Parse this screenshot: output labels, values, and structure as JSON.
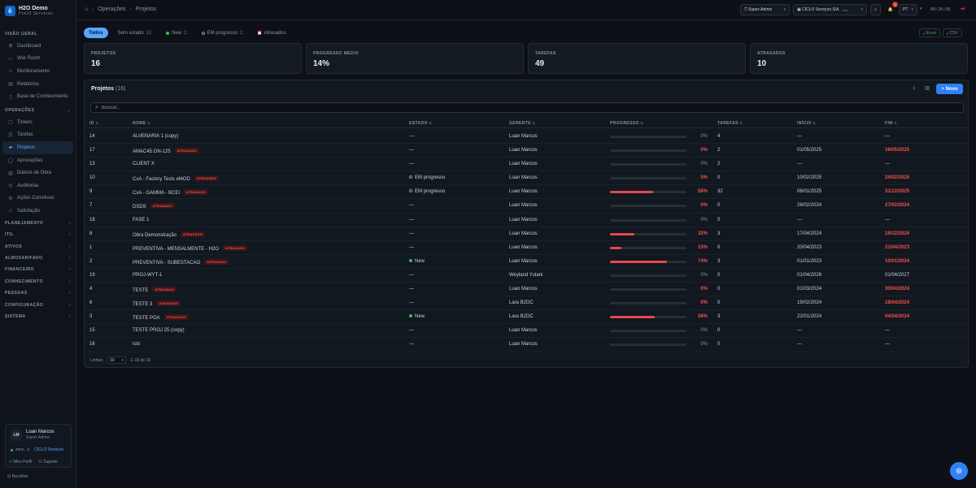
{
  "brand": {
    "title": "H2O Demo",
    "subtitle": "Field Services"
  },
  "sidebar": {
    "sections": [
      {
        "title": "VISÃO GERAL",
        "items": [
          {
            "label": "Dashboard",
            "icon": "grid-icon"
          },
          {
            "label": "War Room",
            "icon": "monitor-icon"
          },
          {
            "label": "Monitoramento",
            "icon": "pulse-icon"
          },
          {
            "label": "Relatórios",
            "icon": "chart-icon"
          },
          {
            "label": "Base de Conhecimento",
            "icon": "book-icon"
          }
        ]
      },
      {
        "title": "OPERAÇÕES",
        "items": [
          {
            "label": "Tickets",
            "icon": "ticket-icon"
          },
          {
            "label": "Tarefas",
            "icon": "tasks-icon"
          },
          {
            "label": "Projetos",
            "icon": "folder-icon",
            "active": true
          },
          {
            "label": "Aprovações",
            "icon": "check-circle-icon"
          },
          {
            "label": "Diários de Obra",
            "icon": "journal-icon"
          },
          {
            "label": "Auditorias",
            "icon": "audit-icon"
          },
          {
            "label": "Ações Corretivas",
            "icon": "wrench-icon"
          },
          {
            "label": "Satisfação",
            "icon": "smile-icon"
          }
        ]
      }
    ],
    "collapsed_sections": [
      "PLANEJAMENTO",
      "ITIL",
      "ATIVOS",
      "ALMOXARIFADO",
      "FINANCEIRO",
      "CONHECIMENTO",
      "PESSOAS",
      "CONFIGURAÇÃO",
      "SISTEMA"
    ],
    "user": {
      "initials": "LM",
      "name": "Luan Marcos",
      "role": "Super-Admin",
      "status": "zonc...s",
      "company": "CICLO Serviços",
      "profile_link": "Meu Perfil",
      "support_link": "Suporte"
    },
    "collapse_label": "Recolher"
  },
  "topbar": {
    "breadcrumbs": [
      "Operações",
      "Projetos"
    ],
    "role_button": "Super-Admin",
    "company_button": "CICLO Serviços S/A",
    "company_tag": "Hub",
    "notifications": "3",
    "language": "PT",
    "clock": "09:26:58"
  },
  "filters": [
    {
      "label": "Todos",
      "active": true
    },
    {
      "label": "Sem estado",
      "count": "12"
    },
    {
      "label": "New",
      "count": "2",
      "dot": "#3fb950"
    },
    {
      "label": "EM progresso",
      "count": "2",
      "dot": "#161b22"
    },
    {
      "label": "Atrasados",
      "icon": "alarm-icon"
    }
  ],
  "exports": {
    "excel": "Excel",
    "csv": "CSV"
  },
  "stats": [
    {
      "label": "PROJETOS",
      "value": "16"
    },
    {
      "label": "PROGRESSO MÉDIO",
      "value": "14%"
    },
    {
      "label": "TAREFAS",
      "value": "49"
    },
    {
      "label": "ATRASADOS",
      "value": "10"
    }
  ],
  "panel": {
    "title": "Projetos",
    "count": "(16)",
    "new_button": "+ Novo",
    "search_placeholder": "Buscar..."
  },
  "columns": [
    "ID",
    "NOME",
    "ESTADO",
    "GERENTE",
    "PROGRESSO",
    "TAREFAS",
    "INÍCIO",
    "FIM"
  ],
  "late_tag": "ATRASADO",
  "rows": [
    {
      "id": "14",
      "name": "ALVENARIA 1 (copy)",
      "late": false,
      "state": "—",
      "state_dot": "",
      "manager": "Luan Marcos",
      "progress": 0,
      "progress_label": "0%",
      "tasks": "4",
      "start": "—",
      "end": "—",
      "end_late": false
    },
    {
      "id": "17",
      "name": "AMAC45.ON-125",
      "late": true,
      "state": "—",
      "state_dot": "",
      "manager": "Luan Marcos",
      "progress": 0,
      "progress_label": "0%",
      "tasks": "2",
      "start": "01/05/2025",
      "end": "16/05/2025",
      "end_late": true
    },
    {
      "id": "13",
      "name": "CLIENT X",
      "late": false,
      "state": "—",
      "state_dot": "",
      "manager": "Luan Marcos",
      "progress": 0,
      "progress_label": "0%",
      "tasks": "2",
      "start": "—",
      "end": "—",
      "end_late": false
    },
    {
      "id": "10",
      "name": "CxA - Factory Tests eMOD",
      "late": true,
      "state": "EM progresso",
      "state_dot": "#161b22",
      "manager": "Luan Marcos",
      "progress": 0,
      "progress_label": "0%",
      "tasks": "0",
      "start": "10/02/2025",
      "end": "24/02/2025",
      "end_late": true
    },
    {
      "id": "9",
      "name": "CxA - GAMMA - BCEI",
      "late": true,
      "state": "EM progresso",
      "state_dot": "#161b22",
      "manager": "Luan Marcos",
      "progress": 56,
      "progress_label": "56%",
      "tasks": "32",
      "start": "06/01/2025",
      "end": "31/12/2025",
      "end_late": true
    },
    {
      "id": "7",
      "name": "DSDS",
      "late": true,
      "state": "—",
      "state_dot": "",
      "manager": "Luan Marcos",
      "progress": 0,
      "progress_label": "0%",
      "tasks": "0",
      "start": "26/02/2024",
      "end": "27/02/2024",
      "end_late": true
    },
    {
      "id": "18",
      "name": "FASE 1",
      "late": false,
      "state": "—",
      "state_dot": "",
      "manager": "Luan Marcos",
      "progress": 0,
      "progress_label": "0%",
      "tasks": "0",
      "start": "—",
      "end": "—",
      "end_late": false
    },
    {
      "id": "8",
      "name": "Obra Demonstração",
      "late": true,
      "state": "—",
      "state_dot": "",
      "manager": "Luan Marcos",
      "progress": 32,
      "progress_label": "32%",
      "tasks": "3",
      "start": "17/04/2024",
      "end": "19/12/2024",
      "end_late": true
    },
    {
      "id": "1",
      "name": "PREVENTIVA - MENSALMENTE - H2O",
      "late": true,
      "state": "—",
      "state_dot": "",
      "manager": "Luan Marcos",
      "progress": 15,
      "progress_label": "15%",
      "tasks": "0",
      "start": "20/04/2023",
      "end": "21/04/2023",
      "end_late": true
    },
    {
      "id": "2",
      "name": "PREVENTIVA - SUBESTACAO",
      "late": true,
      "state": "New",
      "state_dot": "#3fb950",
      "manager": "Luan Marcos",
      "progress": 74,
      "progress_label": "74%",
      "tasks": "3",
      "start": "01/01/2023",
      "end": "10/01/2024",
      "end_late": true
    },
    {
      "id": "19",
      "name": "PROJ-WYT-1",
      "late": false,
      "state": "—",
      "state_dot": "",
      "manager": "Weyland Yutani",
      "progress": 0,
      "progress_label": "0%",
      "tasks": "0",
      "start": "01/04/2026",
      "end": "01/04/2027",
      "end_late": false
    },
    {
      "id": "4",
      "name": "TESTE",
      "late": true,
      "state": "—",
      "state_dot": "",
      "manager": "Luan Marcos",
      "progress": 0,
      "progress_label": "0%",
      "tasks": "0",
      "start": "01/03/2024",
      "end": "30/04/2024",
      "end_late": true
    },
    {
      "id": "6",
      "name": "TESTE 3",
      "late": true,
      "state": "—",
      "state_dot": "",
      "manager": "Lara B2DC",
      "progress": 0,
      "progress_label": "0%",
      "tasks": "0",
      "start": "19/02/2024",
      "end": "18/04/2024",
      "end_late": true
    },
    {
      "id": "3",
      "name": "TESTE POA",
      "late": true,
      "state": "New",
      "state_dot": "#3fb950",
      "manager": "Lara B2DC",
      "progress": 58,
      "progress_label": "58%",
      "tasks": "3",
      "start": "22/01/2024",
      "end": "04/04/2024",
      "end_late": true
    },
    {
      "id": "15",
      "name": "TESTE PROJ 25 (copy)",
      "late": false,
      "state": "—",
      "state_dot": "",
      "manager": "Luan Marcos",
      "progress": 0,
      "progress_label": "0%",
      "tasks": "0",
      "start": "—",
      "end": "—",
      "end_late": false
    },
    {
      "id": "16",
      "name": "tsts",
      "late": false,
      "state": "—",
      "state_dot": "",
      "manager": "Luan Marcos",
      "progress": 0,
      "progress_label": "0%",
      "tasks": "0",
      "start": "—",
      "end": "—",
      "end_late": false
    }
  ],
  "pagination": {
    "rows_label": "Linhas:",
    "page_size": "10",
    "range": "1–16 de 16"
  },
  "colors": {
    "accent": "#2f81f7",
    "late": "#f85149",
    "progress": "#e5484d",
    "background": "#0d1117"
  }
}
